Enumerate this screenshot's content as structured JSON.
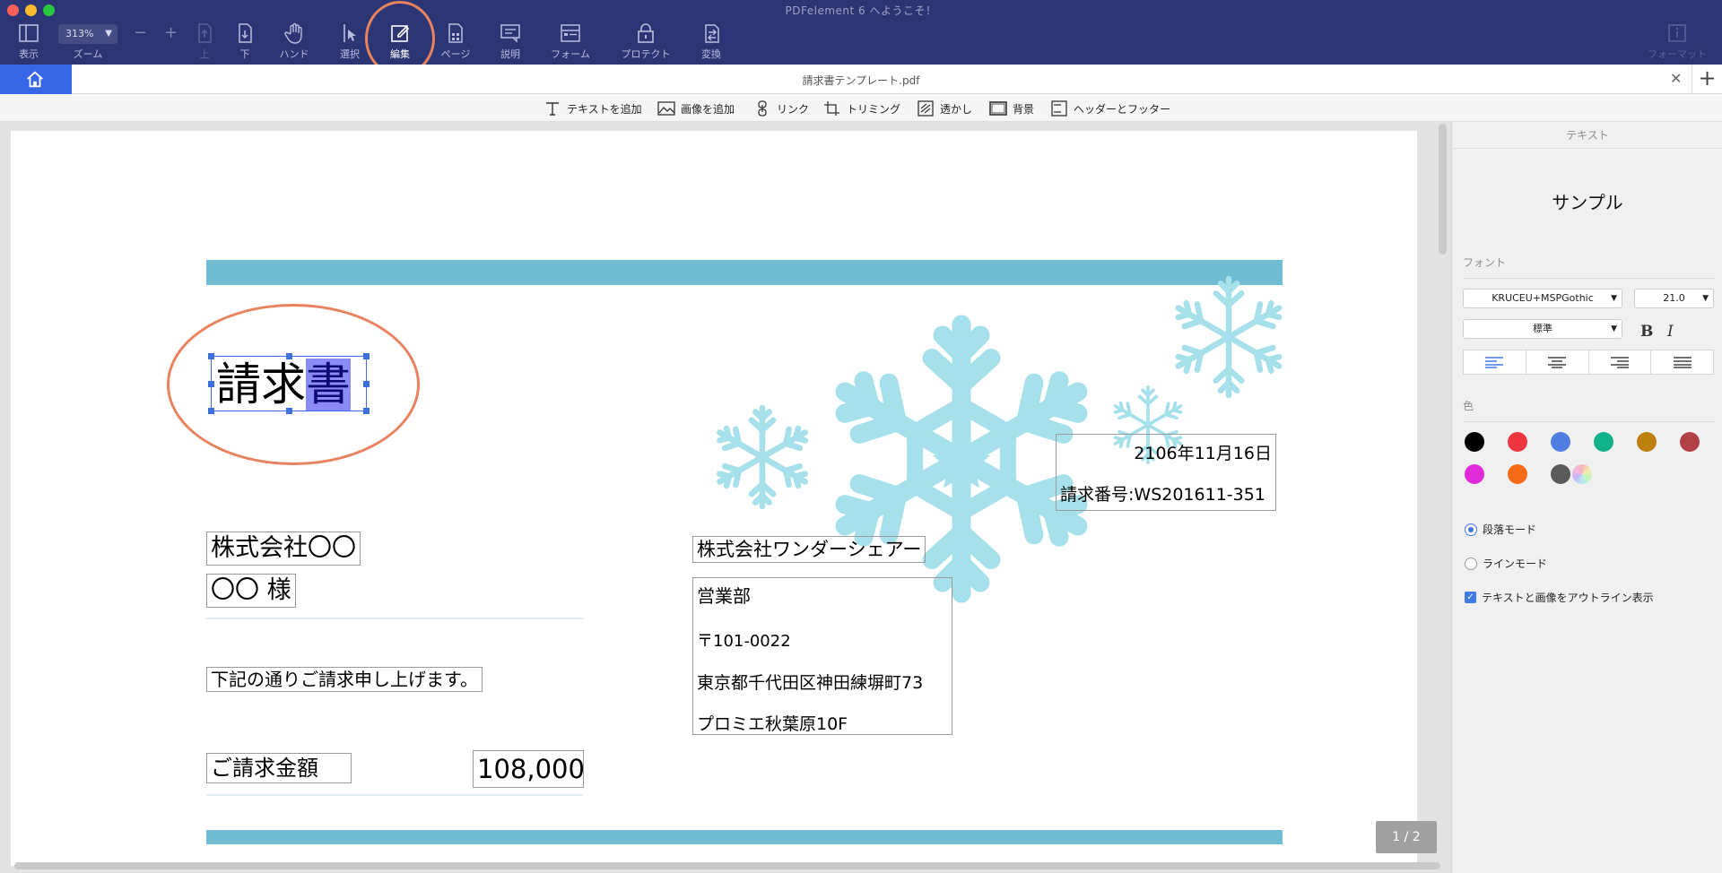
{
  "window": {
    "title": "PDFelement 6 へようこそ！"
  },
  "toolbar": {
    "view_label": "表示",
    "zoom_value": "313%",
    "zoom_label": "ズーム",
    "zoom_minus": "−",
    "zoom_plus": "+",
    "up_label": "上",
    "down_label": "下",
    "hand_label": "ハンド",
    "select_label": "選択",
    "edit_label": "編集",
    "page_label": "ページ",
    "comment_label": "説明",
    "form_label": "フォーム",
    "protect_label": "プロテクト",
    "convert_label": "変換",
    "format_label": "フォーマット"
  },
  "tab": {
    "title": "請求書テンプレート.pdf",
    "close": "✕",
    "add": "+"
  },
  "edit_toolbar": {
    "add_text": "テキストを追加",
    "add_image": "画像を追加",
    "link": "リンク",
    "trim": "トリミング",
    "watermark": "透かし",
    "background": "背景",
    "header_footer": "ヘッダーとフッター"
  },
  "document": {
    "title_part1": "請求",
    "title_part2": "書",
    "date": "2106年11月16日",
    "invoice_no": "請求番号:WS201611-351",
    "client_company": "株式会社〇〇",
    "client_name": "〇〇 様",
    "message": "下記の通りご請求申し上げます。",
    "amount_label": "ご請求金額",
    "amount_value": "108,000",
    "sender_company": "株式会社ワンダーシェアー",
    "sender_dept": "営業部",
    "sender_zip": "〒101-0022",
    "sender_address": "東京都千代田区神田練塀町73",
    "sender_building": "プロミエ秋葉原10F",
    "page_indicator": "1 / 2",
    "accent_color": "#6fbdd3",
    "snowflake_color": "#a6e0ea"
  },
  "panel": {
    "header": "テキスト",
    "sample": "サンプル",
    "font_section": "フォント",
    "font_name": "KRUCEU+MSPGothic",
    "font_size": "21.0",
    "font_style": "標準",
    "bold": "B",
    "italic": "I",
    "color_section": "色",
    "colors": [
      "#000000",
      "#ef3640",
      "#4f7ee3",
      "#12b38b",
      "#bd7f0d",
      "#b24245",
      "#df2bd9",
      "#f56b18",
      "#5a5a5a"
    ],
    "paragraph_mode": "段落モード",
    "line_mode": "ラインモード",
    "outline_option": "テキストと画像をアウトライン表示"
  }
}
